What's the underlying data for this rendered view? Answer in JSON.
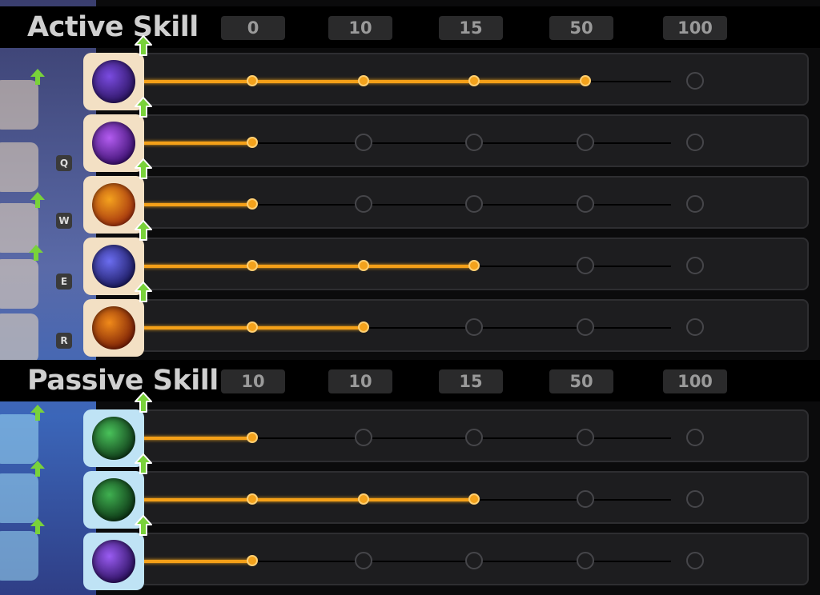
{
  "active": {
    "title": "Active Skill",
    "levels": [
      "0",
      "10",
      "15",
      "50",
      "100"
    ],
    "rows": [
      {
        "icon": "arcane-bubble-skill-icon",
        "colors": [
          "#7a4be0",
          "#2a1360"
        ],
        "frame": "#f3e0c4",
        "progress": 4
      },
      {
        "icon": "violet-totem-skill-icon",
        "colors": [
          "#b35cf0",
          "#3b0f70"
        ],
        "frame": "#f3e0c4",
        "progress": 1
      },
      {
        "icon": "fire-ring-skill-icon",
        "colors": [
          "#f4a21e",
          "#a2300d"
        ],
        "frame": "#f3e0c4",
        "progress": 1
      },
      {
        "icon": "void-swirl-skill-icon",
        "colors": [
          "#6b6df0",
          "#1b1a60"
        ],
        "frame": "#f3e0c4",
        "progress": 3
      },
      {
        "icon": "flame-vortex-skill-icon",
        "colors": [
          "#f08a1a",
          "#7a1e06"
        ],
        "frame": "#f3e0c4",
        "progress": 2
      }
    ]
  },
  "passive": {
    "title": "Passive Skill",
    "levels": [
      "10",
      "10",
      "15",
      "50",
      "100"
    ],
    "rows": [
      {
        "icon": "green-spirit-skill-icon",
        "colors": [
          "#49c25a",
          "#0f3a18"
        ],
        "frame": "#bfe3f5",
        "progress": 1
      },
      {
        "icon": "green-claw-skill-icon",
        "colors": [
          "#3fb050",
          "#0c3414"
        ],
        "frame": "#bfe3f5",
        "progress": 3
      },
      {
        "icon": "purple-sigil-skill-icon",
        "colors": [
          "#9a5cf2",
          "#2a0f5e"
        ],
        "frame": "#bfe3f5",
        "progress": 1
      }
    ]
  },
  "background_keys": [
    "Q",
    "W",
    "E",
    "R"
  ],
  "accent": "#f4a018",
  "upgrade_arrow_color": "#79d23a"
}
